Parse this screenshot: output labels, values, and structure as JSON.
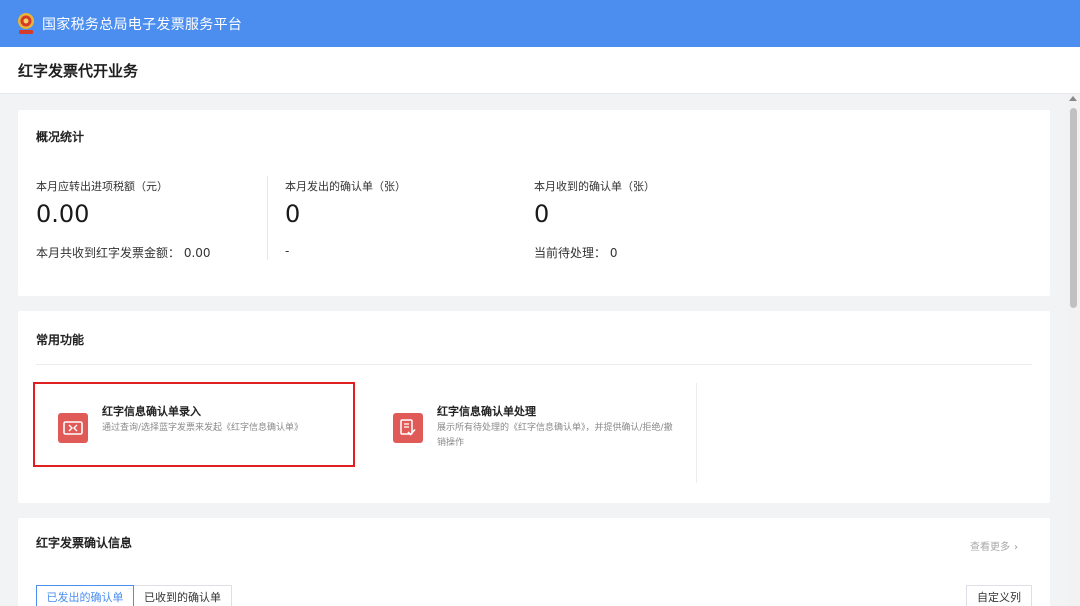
{
  "app": {
    "title": "国家税务总局电子发票服务平台"
  },
  "page": {
    "title": "红字发票代开业务"
  },
  "stats": {
    "title": "概况统计",
    "items": [
      {
        "label": "本月应转出进项税额（元）",
        "value": "0.00",
        "sub": "本月共收到红字发票金额：  0.00"
      },
      {
        "label": "本月发出的确认单（张）",
        "value": "0",
        "sub": "-"
      },
      {
        "label": "本月收到的确认单（张）",
        "value": "0",
        "sub": "当前待处理：  0"
      }
    ]
  },
  "functions": {
    "title": "常用功能",
    "items": [
      {
        "name": "红字信息确认单录入",
        "desc": "通过查询/选择蓝字发票来发起《红字信息确认单》",
        "icon": "invoice-exchange-icon"
      },
      {
        "name": "红字信息确认单处理",
        "desc": "展示所有待处理的《红字信息确认单》，并提供确认/拒绝/撤销操作",
        "icon": "document-check-icon"
      }
    ]
  },
  "red_confirm": {
    "title": "红字发票确认信息",
    "more": "查看更多",
    "tabs": [
      "已发出的确认单",
      "已收到的确认单"
    ],
    "custom_columns": "自定义列"
  },
  "colors": {
    "topbar": "#4b8ef0",
    "accent": "#4b8ef0",
    "icon_bg": "#e05a58",
    "highlight": "#e02020"
  }
}
